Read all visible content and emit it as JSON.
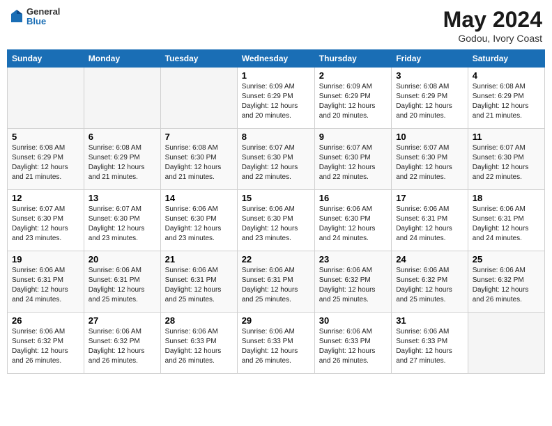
{
  "header": {
    "logo_line1": "General",
    "logo_line2": "Blue",
    "title": "May 2024",
    "subtitle": "Godou, Ivory Coast"
  },
  "columns": [
    "Sunday",
    "Monday",
    "Tuesday",
    "Wednesday",
    "Thursday",
    "Friday",
    "Saturday"
  ],
  "weeks": [
    [
      {
        "day": "",
        "info": ""
      },
      {
        "day": "",
        "info": ""
      },
      {
        "day": "",
        "info": ""
      },
      {
        "day": "1",
        "info": "Sunrise: 6:09 AM\nSunset: 6:29 PM\nDaylight: 12 hours and 20 minutes."
      },
      {
        "day": "2",
        "info": "Sunrise: 6:09 AM\nSunset: 6:29 PM\nDaylight: 12 hours and 20 minutes."
      },
      {
        "day": "3",
        "info": "Sunrise: 6:08 AM\nSunset: 6:29 PM\nDaylight: 12 hours and 20 minutes."
      },
      {
        "day": "4",
        "info": "Sunrise: 6:08 AM\nSunset: 6:29 PM\nDaylight: 12 hours and 21 minutes."
      }
    ],
    [
      {
        "day": "5",
        "info": "Sunrise: 6:08 AM\nSunset: 6:29 PM\nDaylight: 12 hours and 21 minutes."
      },
      {
        "day": "6",
        "info": "Sunrise: 6:08 AM\nSunset: 6:29 PM\nDaylight: 12 hours and 21 minutes."
      },
      {
        "day": "7",
        "info": "Sunrise: 6:08 AM\nSunset: 6:30 PM\nDaylight: 12 hours and 21 minutes."
      },
      {
        "day": "8",
        "info": "Sunrise: 6:07 AM\nSunset: 6:30 PM\nDaylight: 12 hours and 22 minutes."
      },
      {
        "day": "9",
        "info": "Sunrise: 6:07 AM\nSunset: 6:30 PM\nDaylight: 12 hours and 22 minutes."
      },
      {
        "day": "10",
        "info": "Sunrise: 6:07 AM\nSunset: 6:30 PM\nDaylight: 12 hours and 22 minutes."
      },
      {
        "day": "11",
        "info": "Sunrise: 6:07 AM\nSunset: 6:30 PM\nDaylight: 12 hours and 22 minutes."
      }
    ],
    [
      {
        "day": "12",
        "info": "Sunrise: 6:07 AM\nSunset: 6:30 PM\nDaylight: 12 hours and 23 minutes."
      },
      {
        "day": "13",
        "info": "Sunrise: 6:07 AM\nSunset: 6:30 PM\nDaylight: 12 hours and 23 minutes."
      },
      {
        "day": "14",
        "info": "Sunrise: 6:06 AM\nSunset: 6:30 PM\nDaylight: 12 hours and 23 minutes."
      },
      {
        "day": "15",
        "info": "Sunrise: 6:06 AM\nSunset: 6:30 PM\nDaylight: 12 hours and 23 minutes."
      },
      {
        "day": "16",
        "info": "Sunrise: 6:06 AM\nSunset: 6:30 PM\nDaylight: 12 hours and 24 minutes."
      },
      {
        "day": "17",
        "info": "Sunrise: 6:06 AM\nSunset: 6:31 PM\nDaylight: 12 hours and 24 minutes."
      },
      {
        "day": "18",
        "info": "Sunrise: 6:06 AM\nSunset: 6:31 PM\nDaylight: 12 hours and 24 minutes."
      }
    ],
    [
      {
        "day": "19",
        "info": "Sunrise: 6:06 AM\nSunset: 6:31 PM\nDaylight: 12 hours and 24 minutes."
      },
      {
        "day": "20",
        "info": "Sunrise: 6:06 AM\nSunset: 6:31 PM\nDaylight: 12 hours and 25 minutes."
      },
      {
        "day": "21",
        "info": "Sunrise: 6:06 AM\nSunset: 6:31 PM\nDaylight: 12 hours and 25 minutes."
      },
      {
        "day": "22",
        "info": "Sunrise: 6:06 AM\nSunset: 6:31 PM\nDaylight: 12 hours and 25 minutes."
      },
      {
        "day": "23",
        "info": "Sunrise: 6:06 AM\nSunset: 6:32 PM\nDaylight: 12 hours and 25 minutes."
      },
      {
        "day": "24",
        "info": "Sunrise: 6:06 AM\nSunset: 6:32 PM\nDaylight: 12 hours and 25 minutes."
      },
      {
        "day": "25",
        "info": "Sunrise: 6:06 AM\nSunset: 6:32 PM\nDaylight: 12 hours and 26 minutes."
      }
    ],
    [
      {
        "day": "26",
        "info": "Sunrise: 6:06 AM\nSunset: 6:32 PM\nDaylight: 12 hours and 26 minutes."
      },
      {
        "day": "27",
        "info": "Sunrise: 6:06 AM\nSunset: 6:32 PM\nDaylight: 12 hours and 26 minutes."
      },
      {
        "day": "28",
        "info": "Sunrise: 6:06 AM\nSunset: 6:33 PM\nDaylight: 12 hours and 26 minutes."
      },
      {
        "day": "29",
        "info": "Sunrise: 6:06 AM\nSunset: 6:33 PM\nDaylight: 12 hours and 26 minutes."
      },
      {
        "day": "30",
        "info": "Sunrise: 6:06 AM\nSunset: 6:33 PM\nDaylight: 12 hours and 26 minutes."
      },
      {
        "day": "31",
        "info": "Sunrise: 6:06 AM\nSunset: 6:33 PM\nDaylight: 12 hours and 27 minutes."
      },
      {
        "day": "",
        "info": ""
      }
    ]
  ]
}
